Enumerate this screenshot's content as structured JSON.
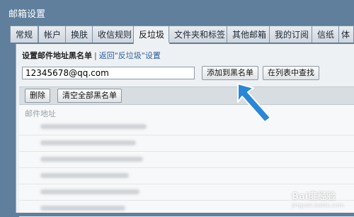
{
  "window": {
    "title": "邮箱设置"
  },
  "tabs": [
    {
      "label": "常规"
    },
    {
      "label": "帐户"
    },
    {
      "label": "换肤"
    },
    {
      "label": "收信规则"
    },
    {
      "label": "反垃圾",
      "active": true
    },
    {
      "label": "文件夹和标签"
    },
    {
      "label": "其他邮箱"
    },
    {
      "label": "我的订阅"
    },
    {
      "label": "信纸"
    },
    {
      "label": "体"
    }
  ],
  "blacklist": {
    "heading": "设置邮件地址黑名单",
    "separator": "|",
    "back_link": "返回\"反垃圾\"设置",
    "input_value": "12345678@qq.com",
    "add_button": "添加到黑名单",
    "find_button": "在列表中查找",
    "delete_button": "删除",
    "clear_button": "清空全部黑名单",
    "column_header": "邮件地址"
  },
  "watermark": {
    "brand": "Bai度经验",
    "url": "jingyan.baidu.com"
  },
  "colors": {
    "accent_arrow": "#2a87d8",
    "titlebar": "#5f7f9c",
    "link": "#2a5d9f"
  }
}
